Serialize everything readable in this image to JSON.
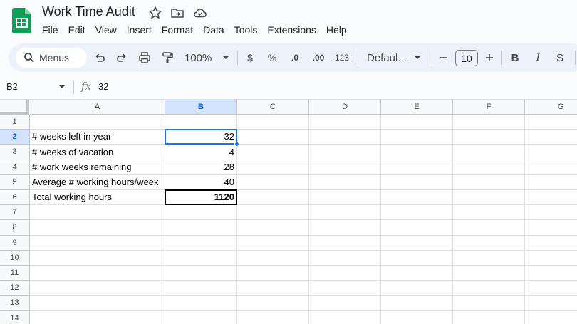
{
  "document": {
    "title": "Work Time Audit"
  },
  "menu": [
    "File",
    "Edit",
    "View",
    "Insert",
    "Format",
    "Data",
    "Tools",
    "Extensions",
    "Help"
  ],
  "toolbar": {
    "search_label": "Menus",
    "zoom": "100%",
    "currency": "$",
    "percent": "%",
    "decrease_decimal": ".0",
    "increase_decimal": ".00",
    "number_format": "123",
    "font": "Defaul...",
    "font_size": "10",
    "bold": "B",
    "italic": "I",
    "strike": "S"
  },
  "formula_bar": {
    "name_box": "B2",
    "fx": "fx",
    "formula": "32"
  },
  "grid": {
    "columns": [
      "A",
      "B",
      "C",
      "D",
      "E",
      "F",
      "G"
    ],
    "selected_column": "B",
    "rows": [
      "1",
      "2",
      "3",
      "4",
      "5",
      "6",
      "7",
      "8",
      "9",
      "10",
      "11",
      "12",
      "13",
      "14"
    ],
    "selected_row": "2",
    "cells": [
      {
        "row": 2,
        "label": "# weeks left in year",
        "value": "32"
      },
      {
        "row": 3,
        "label": "# weeks of vacation",
        "value": "4"
      },
      {
        "row": 4,
        "label": "# work weeks remaining",
        "value": "28"
      },
      {
        "row": 5,
        "label": "Average # working hours/week",
        "value": "40"
      },
      {
        "row": 6,
        "label": "Total working hours",
        "value": "1120"
      }
    ]
  },
  "colors": {
    "accent": "#1a73e8",
    "header_selected": "#d3e3fd",
    "toolbar_bg": "#edf2fa",
    "sheets_green": "#0f9d58"
  }
}
